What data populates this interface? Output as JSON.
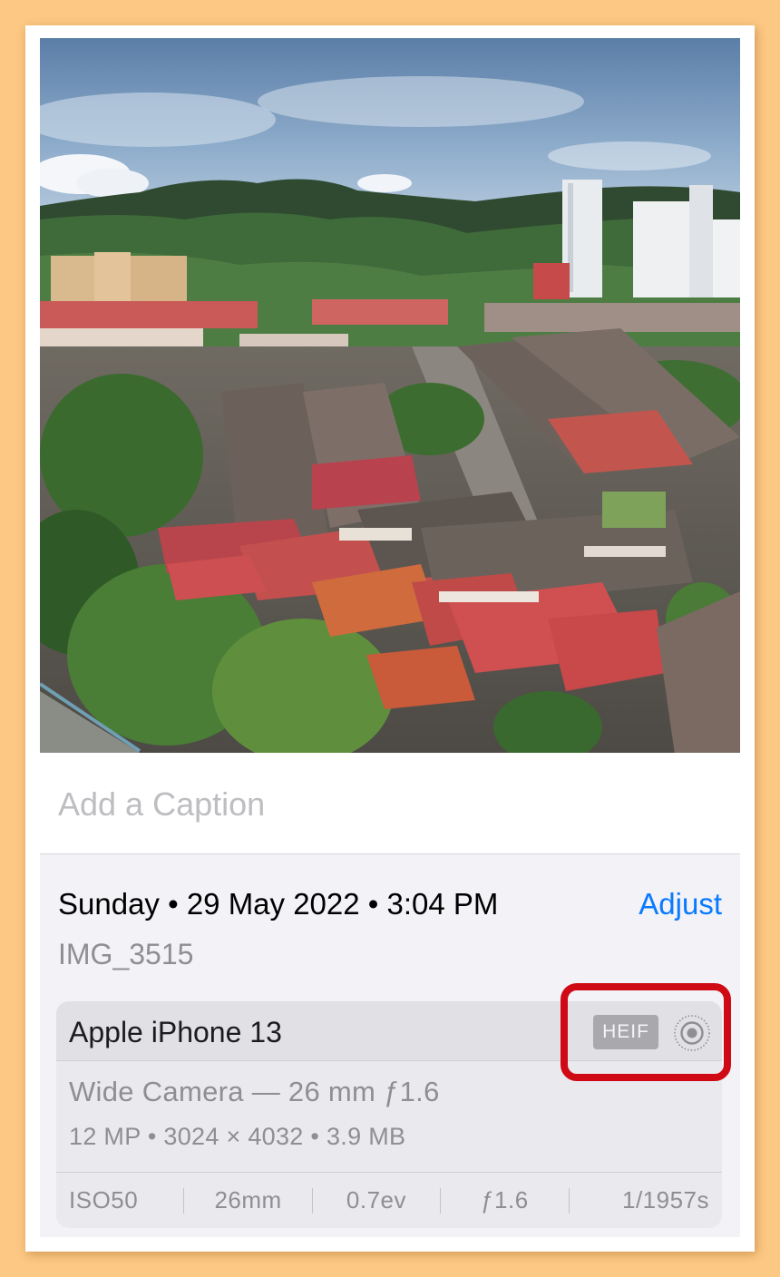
{
  "caption": {
    "placeholder": "Add a Caption"
  },
  "info": {
    "date_line": "Sunday • 29 May 2022 • 3:04 PM",
    "adjust_label": "Adjust",
    "filename": "IMG_3515"
  },
  "device": {
    "name": "Apple iPhone 13",
    "format_badge": "HEIF",
    "live_icon": "live-photo-icon",
    "camera": "Wide Camera — 26 mm ƒ1.6",
    "specs": "12 MP • 3024 × 4032 • 3.9 MB",
    "exif": [
      "ISO50",
      "26mm",
      "0.7ev",
      "ƒ1.6",
      "1/1957s"
    ]
  },
  "colors": {
    "background": "#fdc883",
    "accent": "#0a7aff",
    "highlight": "#cf0a14"
  }
}
